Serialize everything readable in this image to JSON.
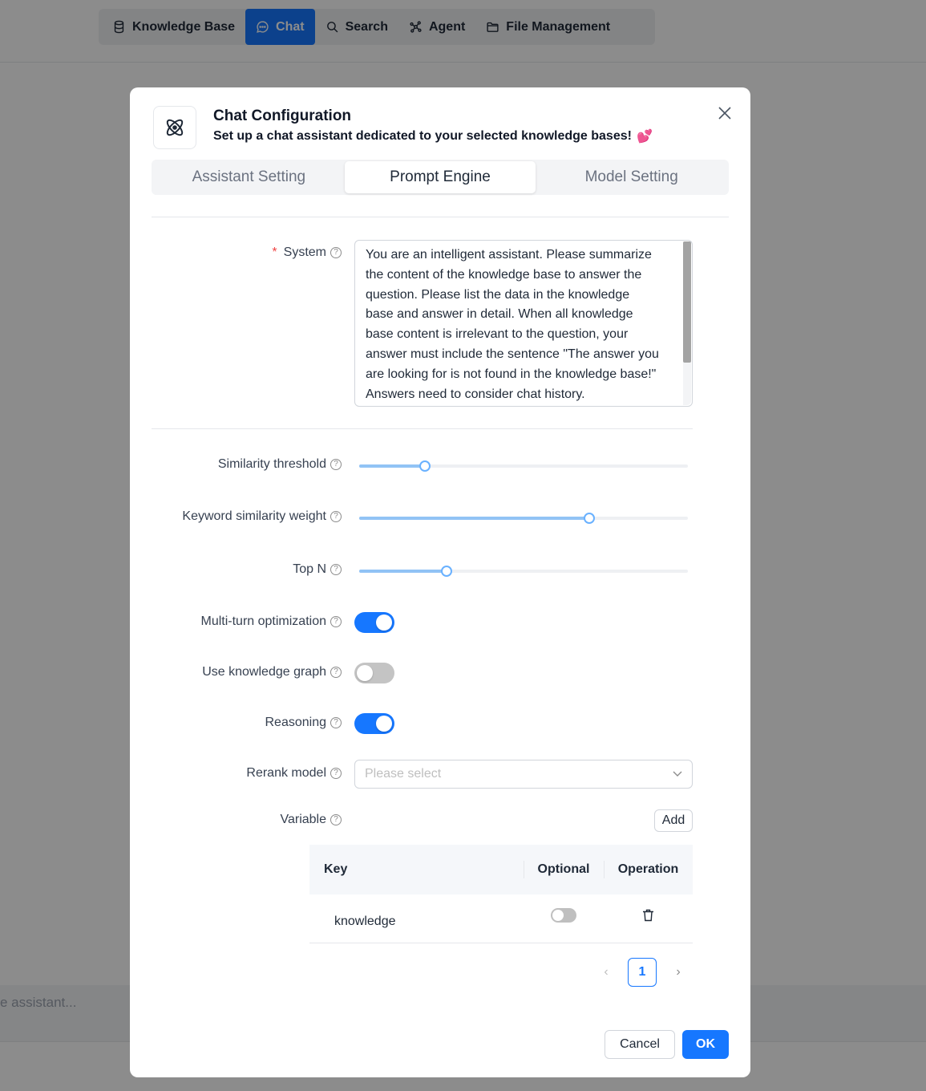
{
  "nav": {
    "items": [
      {
        "label": "Knowledge Base",
        "icon": "database-icon"
      },
      {
        "label": "Chat",
        "icon": "chat-bubble-icon",
        "active": true
      },
      {
        "label": "Search",
        "icon": "search-icon"
      },
      {
        "label": "Agent",
        "icon": "agent-graph-icon"
      },
      {
        "label": "File Management",
        "icon": "folder-icon"
      }
    ]
  },
  "background": {
    "input_placeholder": "e assistant..."
  },
  "modal": {
    "title": "Chat Configuration",
    "subtitle": "Set up a chat assistant dedicated to your selected knowledge bases!",
    "subtitle_emoji": "💕",
    "tabs": [
      {
        "label": "Assistant Setting"
      },
      {
        "label": "Prompt Engine",
        "active": true
      },
      {
        "label": "Model Setting"
      }
    ],
    "help_glyph": "?",
    "system": {
      "label": "System",
      "required_mark": "*",
      "value": "You are an intelligent assistant. Please summarize the content of the knowledge base to answer the question. Please list the data in the knowledge base and answer in detail. When all knowledge base content is irrelevant to the question, your answer must include the sentence \"The answer you are looking for is not found in the knowledge base!\" Answers need to consider chat history."
    },
    "similarity_threshold": {
      "label": "Similarity threshold",
      "level": 0.2
    },
    "keyword_similarity_weight": {
      "label": "Keyword similarity weight",
      "level": 0.7
    },
    "top_n": {
      "label": "Top N",
      "level": 0.267
    },
    "multi_turn": {
      "label": "Multi-turn optimization",
      "on": true
    },
    "knowledge_graph": {
      "label": "Use knowledge graph",
      "on": false
    },
    "reasoning": {
      "label": "Reasoning",
      "on": true
    },
    "rerank_model": {
      "label": "Rerank model",
      "placeholder": "Please select"
    },
    "variable": {
      "label": "Variable",
      "add_label": "Add",
      "columns": [
        "Key",
        "Optional",
        "Operation"
      ],
      "rows": [
        {
          "key": "knowledge",
          "optional": false
        }
      ]
    },
    "pagination": {
      "current": "1",
      "prev": "‹",
      "next": "›"
    },
    "cancel_label": "Cancel",
    "ok_label": "OK"
  },
  "colors": {
    "primary": "#1677ff",
    "slider_fill": "#91c3f5",
    "required": "#ef4444"
  }
}
